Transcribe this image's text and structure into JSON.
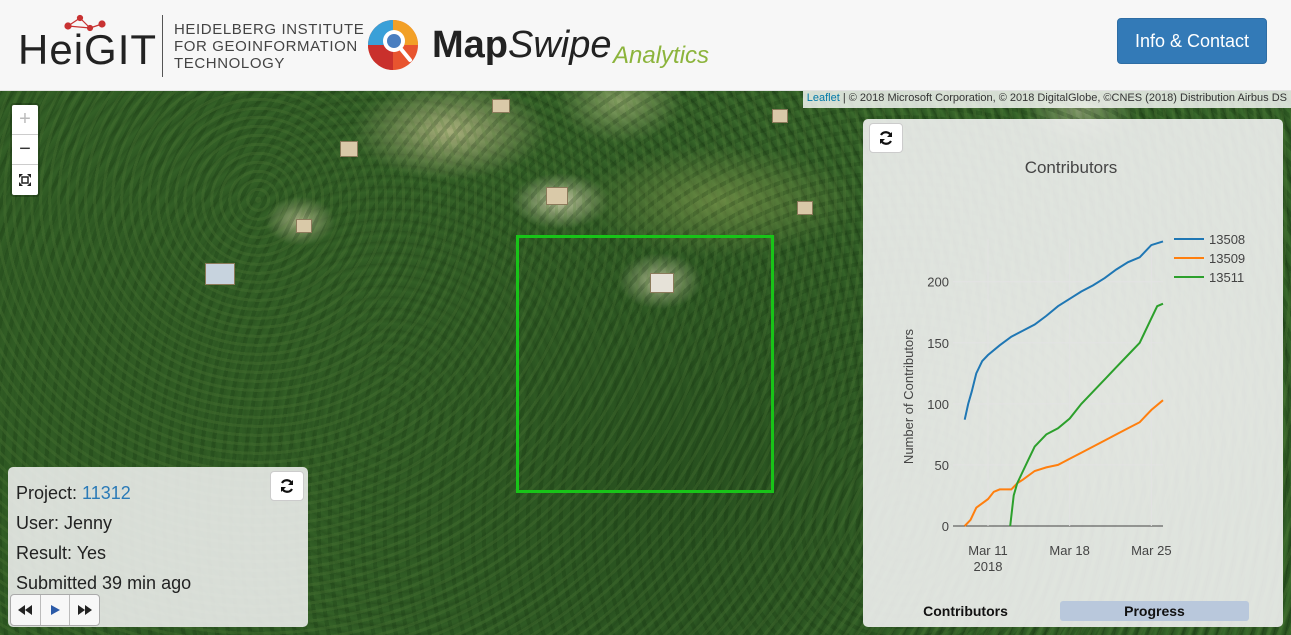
{
  "header": {
    "heigit_logo_text": "HeiGIT",
    "heigit_name_lines": [
      "HEIDELBERG INSTITUTE",
      "FOR GEOINFORMATION",
      "TECHNOLOGY"
    ],
    "mapswipe_bold": "Map",
    "mapswipe_italic": "Swipe",
    "mapswipe_analytics": "Analytics",
    "info_button": "Info & Contact"
  },
  "map": {
    "attribution_link": "Leaflet",
    "attribution_text": " | © 2018 Microsoft Corporation, © 2018 DigitalGlobe, ©CNES (2018) Distribution Airbus DS",
    "zoom_in": "+",
    "zoom_out": "−",
    "colors": {
      "tile_outline": "#18c418"
    }
  },
  "info_panel": {
    "project_label": "Project: ",
    "project_id": "11312",
    "user": "User: Jenny",
    "result": "Result: Yes",
    "submitted": "Submitted 39 min ago"
  },
  "chart_panel": {
    "tabs": {
      "contributors": "Contributors",
      "progress": "Progress"
    },
    "chart_data": {
      "type": "line",
      "title": "Contributors",
      "xlabel": "",
      "ylabel": "Number of Contributors",
      "x_ticks": [
        "Mar 11\n2018",
        "Mar 18",
        "Mar 25"
      ],
      "y_ticks": [
        0,
        50,
        100,
        150,
        200
      ],
      "xlim_days": [
        8,
        26
      ],
      "ylim": [
        0,
        235
      ],
      "legend_position": "top-right",
      "series": [
        {
          "name": "13508",
          "color": "#1f77b4",
          "x": [
            9,
            9.3,
            9.6,
            10,
            10.5,
            11,
            12,
            13,
            14,
            15,
            16,
            17,
            18,
            19,
            20,
            21,
            22,
            23,
            24,
            25,
            26
          ],
          "y": [
            87,
            100,
            110,
            125,
            135,
            140,
            148,
            155,
            160,
            165,
            172,
            180,
            186,
            192,
            197,
            203,
            210,
            216,
            220,
            230,
            233
          ]
        },
        {
          "name": "13509",
          "color": "#ff7f0e",
          "x": [
            9,
            9.5,
            10,
            11,
            11.5,
            12,
            13,
            13.5,
            14,
            15,
            16,
            17,
            18,
            19,
            20,
            21,
            22,
            23,
            24,
            25,
            26
          ],
          "y": [
            0,
            5,
            15,
            22,
            28,
            30,
            30,
            35,
            38,
            45,
            48,
            50,
            55,
            60,
            65,
            70,
            75,
            80,
            85,
            95,
            103
          ]
        },
        {
          "name": "13511",
          "color": "#2ca02c",
          "x": [
            12.9,
            13.2,
            13.5,
            14,
            14.5,
            15,
            16,
            17,
            18,
            19,
            20,
            21,
            22,
            23,
            24,
            25,
            25.5,
            26
          ],
          "y": [
            0,
            25,
            35,
            45,
            55,
            65,
            75,
            80,
            88,
            100,
            110,
            120,
            130,
            140,
            150,
            170,
            180,
            182
          ]
        }
      ]
    }
  }
}
